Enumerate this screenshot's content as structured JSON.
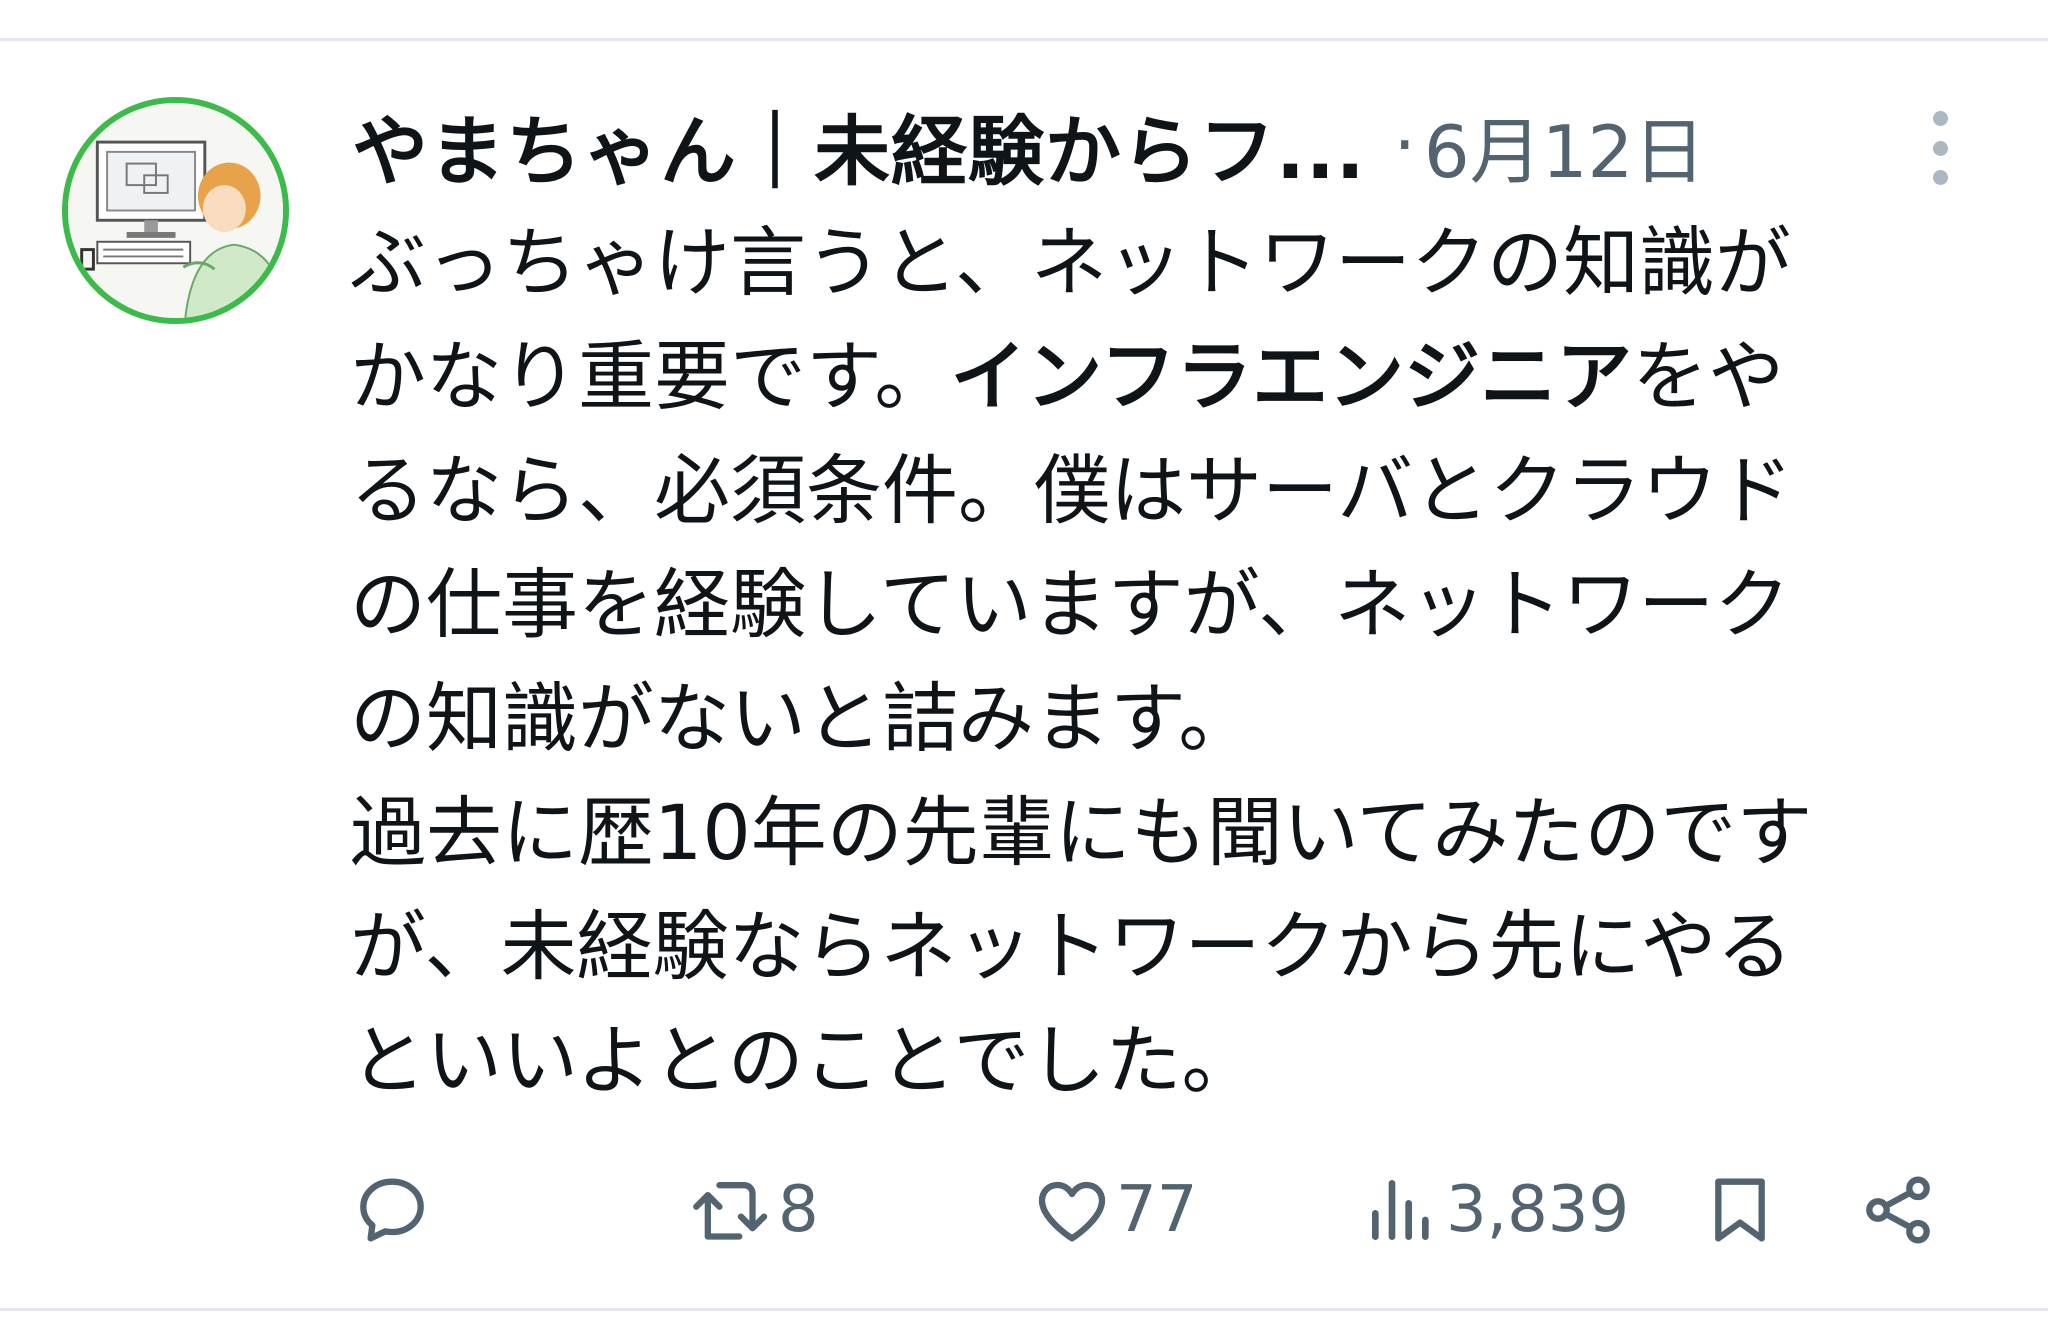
{
  "tweet": {
    "author": {
      "display_name": "やまちゃん｜未経験からフ...",
      "avatar_icon": "avatar-illustration-icon"
    },
    "separator": "·",
    "timestamp": "6月12日",
    "more_icon": "more-vertical-icon",
    "text": {
      "line1": "ぶっちゃけ言うと、ネットワークの知識が",
      "line2_pre": "かなり重要です。",
      "line2_bold": "インフラエンジニア",
      "line2_post": "をや",
      "line3": "るなら、必須条件。僕はサーバとクラウド",
      "line4": "の仕事を経験していますが、ネットワーク",
      "line5": "の知識がないと詰みます。",
      "line6": "過去に歴10年の先輩にも聞いてみたのです",
      "line7": "が、未経験ならネットワークから先にやる",
      "line8": "といいよとのことでした。"
    },
    "actions": {
      "reply": {
        "icon": "reply-icon",
        "count": ""
      },
      "retweet": {
        "icon": "retweet-icon",
        "count": "8"
      },
      "like": {
        "icon": "heart-icon",
        "count": "77"
      },
      "views": {
        "icon": "views-chart-icon",
        "count": "3,839"
      },
      "bookmark": {
        "icon": "bookmark-icon"
      },
      "share": {
        "icon": "share-icon"
      }
    },
    "colors": {
      "text": "#0f1419",
      "secondary": "#536471",
      "avatar_border": "#3dbb4a",
      "divider": "#e4e8ec"
    }
  }
}
